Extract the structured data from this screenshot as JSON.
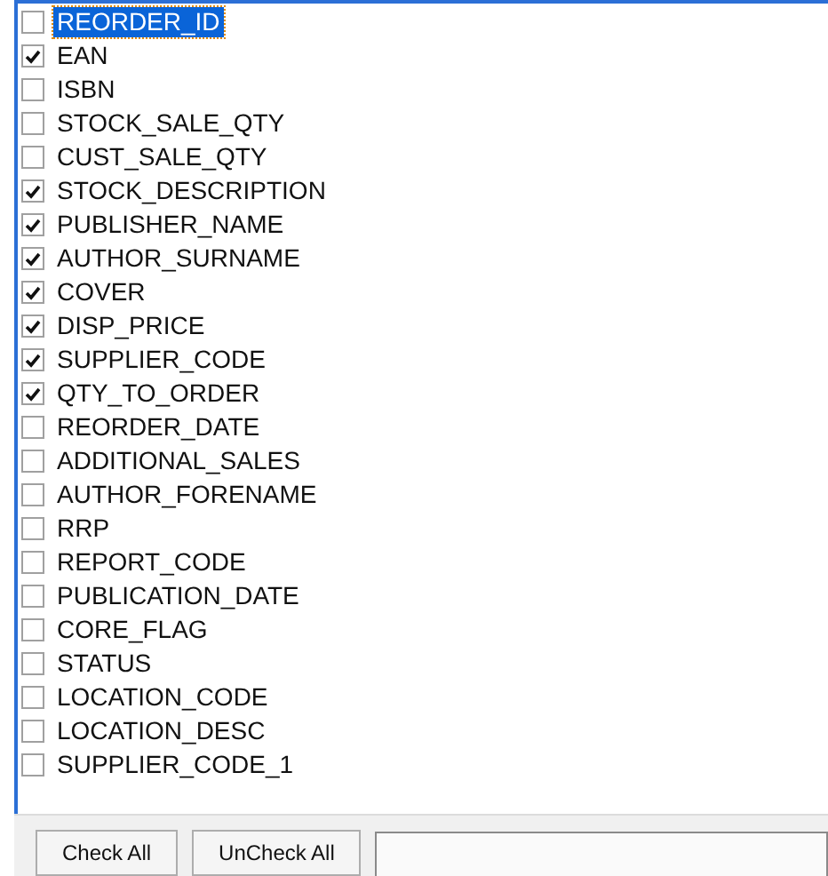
{
  "fields": [
    {
      "label": "REORDER_ID",
      "checked": false,
      "selected": true
    },
    {
      "label": "EAN",
      "checked": true,
      "selected": false
    },
    {
      "label": "ISBN",
      "checked": false,
      "selected": false
    },
    {
      "label": "STOCK_SALE_QTY",
      "checked": false,
      "selected": false
    },
    {
      "label": "CUST_SALE_QTY",
      "checked": false,
      "selected": false
    },
    {
      "label": "STOCK_DESCRIPTION",
      "checked": true,
      "selected": false
    },
    {
      "label": "PUBLISHER_NAME",
      "checked": true,
      "selected": false
    },
    {
      "label": "AUTHOR_SURNAME",
      "checked": true,
      "selected": false
    },
    {
      "label": "COVER",
      "checked": true,
      "selected": false
    },
    {
      "label": "DISP_PRICE",
      "checked": true,
      "selected": false
    },
    {
      "label": "SUPPLIER_CODE",
      "checked": true,
      "selected": false
    },
    {
      "label": "QTY_TO_ORDER",
      "checked": true,
      "selected": false
    },
    {
      "label": "REORDER_DATE",
      "checked": false,
      "selected": false
    },
    {
      "label": "ADDITIONAL_SALES",
      "checked": false,
      "selected": false
    },
    {
      "label": "AUTHOR_FORENAME",
      "checked": false,
      "selected": false
    },
    {
      "label": "RRP",
      "checked": false,
      "selected": false
    },
    {
      "label": "REPORT_CODE",
      "checked": false,
      "selected": false
    },
    {
      "label": "PUBLICATION_DATE",
      "checked": false,
      "selected": false
    },
    {
      "label": "CORE_FLAG",
      "checked": false,
      "selected": false
    },
    {
      "label": "STATUS",
      "checked": false,
      "selected": false
    },
    {
      "label": "LOCATION_CODE",
      "checked": false,
      "selected": false
    },
    {
      "label": "LOCATION_DESC",
      "checked": false,
      "selected": false
    },
    {
      "label": "SUPPLIER_CODE_1",
      "checked": false,
      "selected": false
    }
  ],
  "buttons": [
    "Check All",
    "UnCheck All"
  ]
}
